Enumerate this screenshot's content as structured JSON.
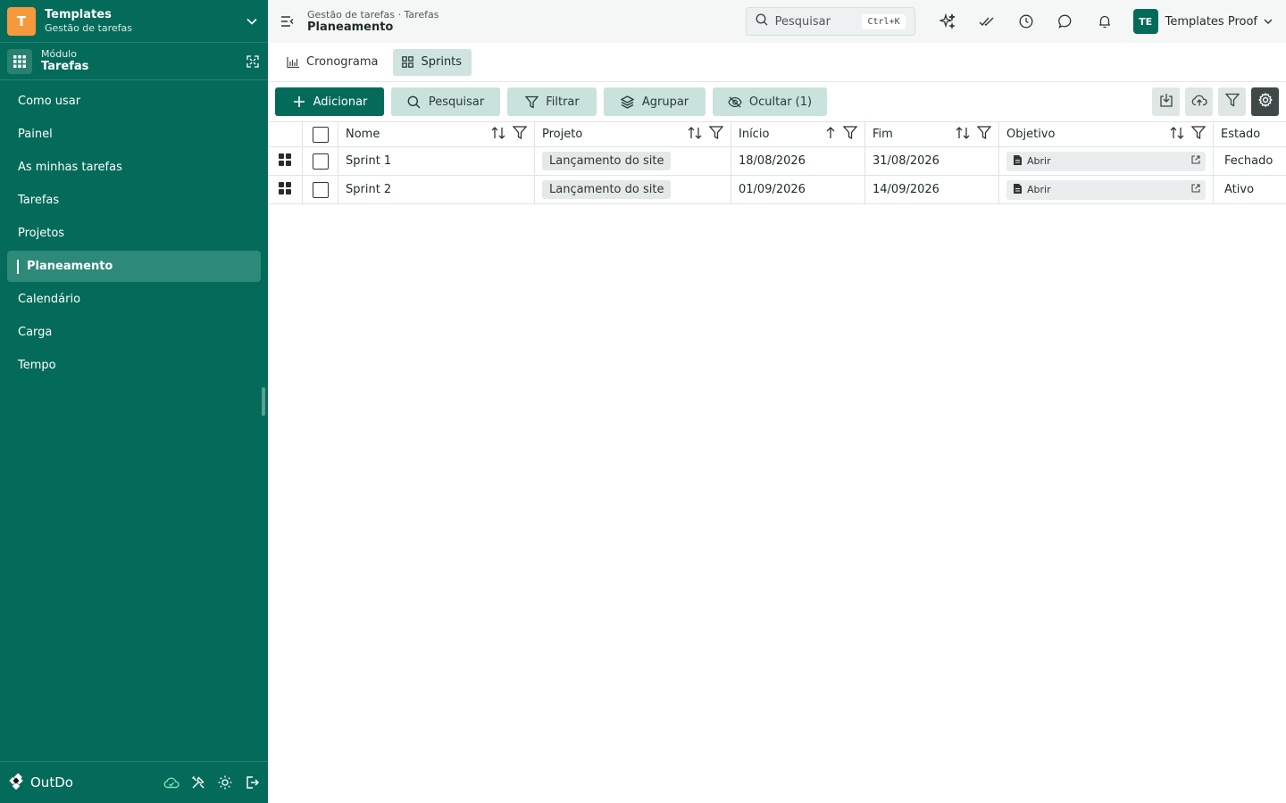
{
  "workspace": {
    "logo_letter": "T",
    "title": "Templates",
    "subtitle": "Gestão de tarefas"
  },
  "module": {
    "label": "Módulo",
    "name": "Tarefas"
  },
  "sidebar": {
    "items": [
      {
        "label": "Como usar"
      },
      {
        "label": "Painel"
      },
      {
        "label": "As minhas tarefas"
      },
      {
        "label": "Tarefas"
      },
      {
        "label": "Projetos"
      },
      {
        "label": "Planeamento",
        "active": true
      },
      {
        "label": "Calendário"
      },
      {
        "label": "Carga"
      },
      {
        "label": "Tempo"
      }
    ],
    "brand": "OutDo"
  },
  "header": {
    "breadcrumb": "Gestão de tarefas · Tarefas",
    "title": "Planeamento",
    "search_placeholder": "Pesquisar",
    "search_shortcut": "Ctrl+K",
    "user_initials": "TE",
    "user_name": "Templates Proof"
  },
  "tabs": [
    {
      "label": "Cronograma",
      "icon": "bar-chart-icon",
      "active": false
    },
    {
      "label": "Sprints",
      "icon": "grid-icon",
      "active": true
    }
  ],
  "toolbar": {
    "add": "Adicionar",
    "search": "Pesquisar",
    "filter": "Filtrar",
    "group": "Agrupar",
    "hide": "Ocultar (1)"
  },
  "table": {
    "columns": {
      "nome": "Nome",
      "projeto": "Projeto",
      "inicio": "Início",
      "fim": "Fim",
      "objetivo": "Objetivo",
      "estado": "Estado"
    },
    "rows": [
      {
        "nome": "Sprint 1",
        "projeto": "Lançamento do site",
        "inicio": "18/08/2026",
        "fim": "31/08/2026",
        "objetivo": "Abrir",
        "estado": "Fechado"
      },
      {
        "nome": "Sprint 2",
        "projeto": "Lançamento do site",
        "inicio": "01/09/2026",
        "fim": "14/09/2026",
        "objetivo": "Abrir",
        "estado": "Ativo"
      }
    ]
  },
  "colors": {
    "brand": "#046b5a",
    "sidebar_active": "#2e8a78",
    "accent_soft": "#c9e2dc",
    "logo": "#f59a3c"
  }
}
